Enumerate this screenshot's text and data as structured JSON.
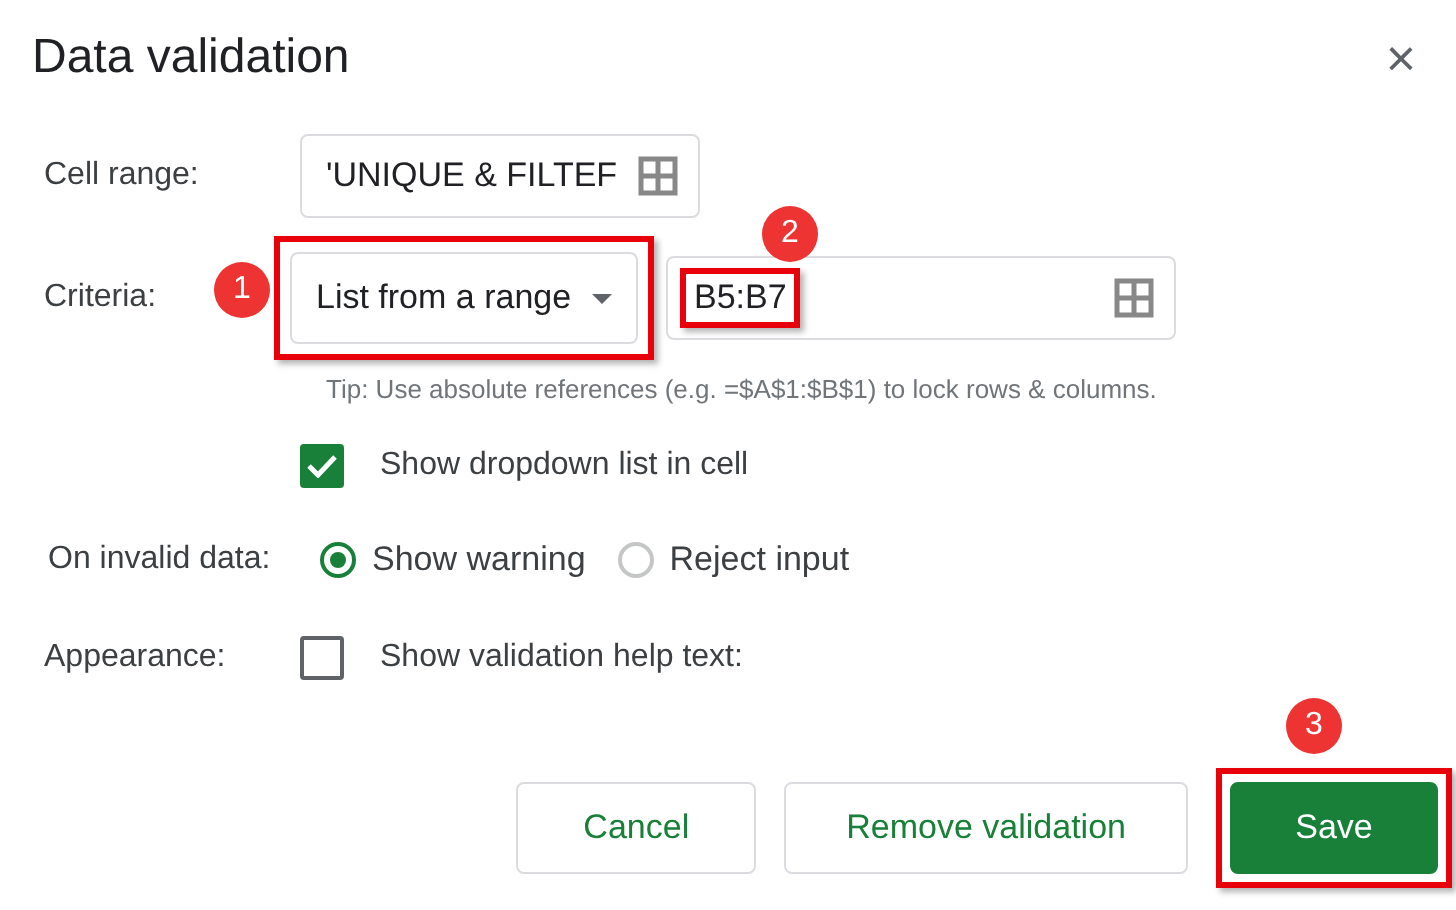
{
  "dialog": {
    "title": "Data validation",
    "close": "×"
  },
  "cell_range": {
    "label": "Cell range:",
    "value": "'UNIQUE & FILTEF"
  },
  "criteria": {
    "label": "Criteria:",
    "dropdown": {
      "value": "List from a range",
      "highlighted": true,
      "callout": "1"
    },
    "range": {
      "value": "B5:B7",
      "highlighted": true,
      "callout": "2"
    },
    "tip": "Tip: Use absolute references (e.g. =$A$1:$B$1) to lock rows & columns."
  },
  "show_dropdown": {
    "label": "Show dropdown list in cell",
    "checked": true
  },
  "invalid_data": {
    "label": "On invalid data:",
    "options": [
      {
        "label": "Show warning",
        "selected": true
      },
      {
        "label": "Reject input",
        "selected": false
      }
    ]
  },
  "appearance": {
    "label": "Appearance:",
    "option": {
      "label": "Show validation help text:",
      "checked": false
    }
  },
  "buttons": [
    {
      "label": "Cancel",
      "kind": "secondary",
      "highlighted": false
    },
    {
      "label": "Remove validation",
      "kind": "secondary",
      "highlighted": false
    },
    {
      "label": "Save",
      "kind": "primary",
      "highlighted": true,
      "callout": "3"
    }
  ]
}
